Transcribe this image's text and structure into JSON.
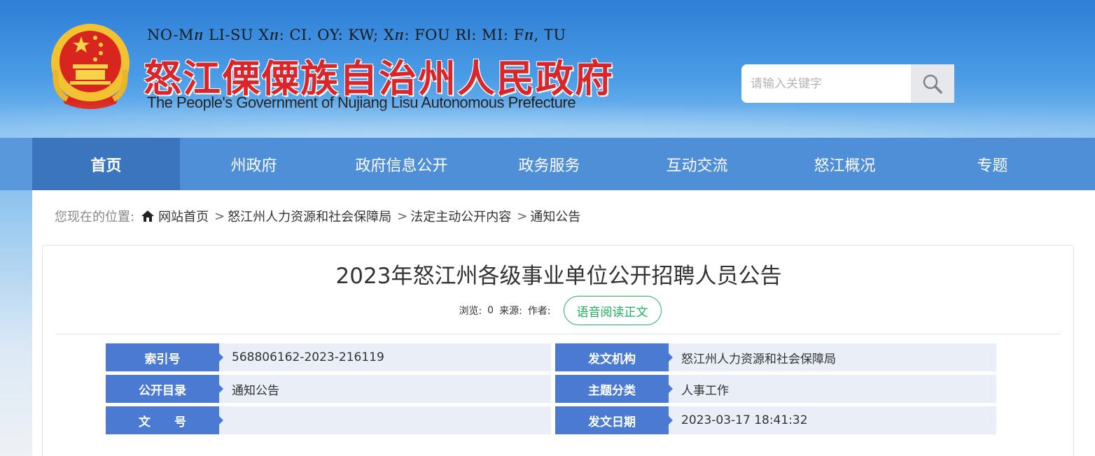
{
  "header": {
    "title_lisu": "NO-Mⴖ LI-SU Xⴖ: CI. OY: KW; Xⴖ: FOU Rꓲ: MI: Fⴖ, ꓔU",
    "title_cn": "怒江傈僳族自治州人民政府",
    "title_en": "The People's Government of Nujiang Lisu Autonomous Prefecture",
    "emblem_icon": "national-emblem-icon",
    "search": {
      "placeholder": "请输入关键字",
      "icon": "search-icon"
    }
  },
  "nav": {
    "items": [
      {
        "label": "首页",
        "active": true
      },
      {
        "label": "州政府"
      },
      {
        "label": "政府信息公开"
      },
      {
        "label": "政务服务"
      },
      {
        "label": "互动交流"
      },
      {
        "label": "怒江概况"
      },
      {
        "label": "专题"
      }
    ]
  },
  "breadcrumb": {
    "lead": "您现在的位置:",
    "items": [
      "网站首页",
      "怒江州人力资源和社会保障局",
      "法定主动公开内容",
      "通知公告"
    ]
  },
  "article": {
    "title": "2023年怒江州各级事业单位公开招聘人员公告",
    "meta": {
      "views_label": "浏览:",
      "views": "0",
      "source_label": "来源:",
      "author_label": "作者:"
    },
    "voice_button": "语音阅读正文"
  },
  "info": {
    "rows": [
      [
        {
          "label": "索引号",
          "value": "568806162-2023-216119"
        },
        {
          "label": "发文机构",
          "value": "怒江州人力资源和社会保障局"
        }
      ],
      [
        {
          "label": "公开目录",
          "value": "通知公告"
        },
        {
          "label": "主题分类",
          "value": "人事工作"
        }
      ],
      [
        {
          "label": "文　　号",
          "value": ""
        },
        {
          "label": "发文日期",
          "value": "2023-03-17 18:41:32"
        }
      ]
    ]
  },
  "colors": {
    "nav_bg": "#4f8fd8",
    "nav_active": "#3a75bd",
    "title_red": "#d9262b",
    "label_blue": "#4a7ad2",
    "voice_green": "#1fae5e"
  }
}
